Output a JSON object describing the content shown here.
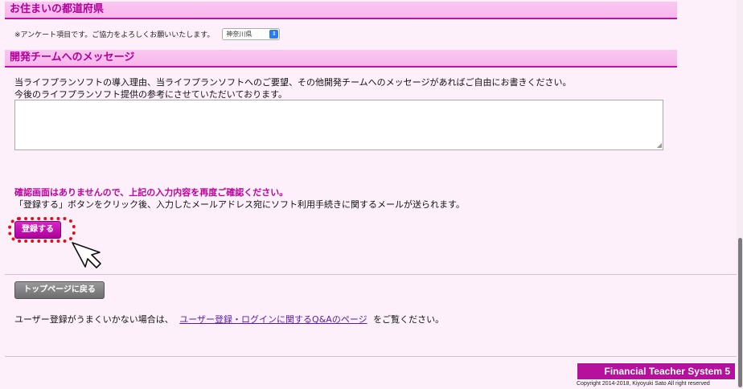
{
  "prefecture_section": {
    "title": "お住まいの都道府県",
    "note": "※アンケート項目です。ご協力をよろしくお願いいたします。",
    "selected": "神奈川県"
  },
  "message_section": {
    "title": "開発チームへのメッセージ",
    "line1": "当ライフプランソフトの導入理由、当ライフプランソフトへのご要望、その他開発チームへのメッセージがあればご自由にお書きください。",
    "line2": "今後のライフプランソフト提供の参考にさせていただいております。",
    "textarea_value": ""
  },
  "notice": {
    "line1": "確認画面はありませんので、上記の入力内容を再度ご確認ください。",
    "line2": "「登録する」ボタンをクリック後、入力したメールアドレス宛にソフト利用手続きに関するメールが送られます。"
  },
  "buttons": {
    "register": "登録する",
    "top_page": "トップページに戻る"
  },
  "help": {
    "prefix": "ユーザー登録がうまくいかない場合は、",
    "link": "ユーザー登録・ログインに関するQ&Aのページ",
    "suffix": "をご覧ください。"
  },
  "footer": {
    "brand": "Financial Teacher System 5",
    "copyright": "Copyright 2014-2018, Kiyoyuki Sato All right reserved"
  },
  "colors": {
    "accent": "#b5119c",
    "header_bg": "#f7b6ec",
    "highlight": "#e0101a"
  },
  "icons": {
    "select_arrow": "select-arrows-icon",
    "cursor": "mouse-pointer-icon"
  }
}
